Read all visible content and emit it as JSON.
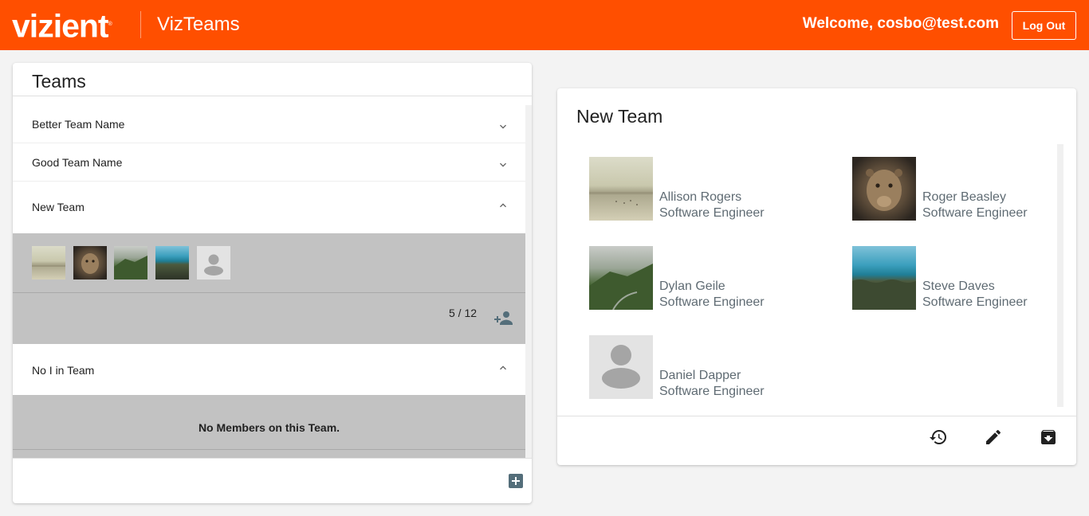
{
  "header": {
    "brand": "vizient",
    "app_name": "VizTeams",
    "welcome": "Welcome, cosbo@test.com",
    "logout_label": "Log Out",
    "bg_color": "#ff4f00"
  },
  "teams_panel": {
    "title": "Teams",
    "teams": [
      {
        "name": "Better Team Name",
        "expanded": false,
        "icon": "chevron-down-icon"
      },
      {
        "name": "Good Team Name",
        "expanded": false,
        "icon": "chevron-down-icon"
      },
      {
        "name": "New Team",
        "expanded": true,
        "icon": "chevron-up-icon",
        "member_count": "5 / 12",
        "thumbnails": [
          "beach-photo",
          "lion-photo",
          "cliff-photo",
          "sea-photo",
          "default-avatar-icon"
        ]
      },
      {
        "name": "No I in Team",
        "expanded": true,
        "icon": "chevron-up-icon",
        "empty_message": "No Members on this Team."
      }
    ],
    "add_team_icon": "add-box-icon"
  },
  "team_detail": {
    "title": "New Team",
    "members": [
      {
        "name": "Allison Rogers",
        "role": "Software Engineer",
        "photo": "beach-photo"
      },
      {
        "name": "Roger Beasley",
        "role": "Software Engineer",
        "photo": "lion-photo"
      },
      {
        "name": "Dylan Geile",
        "role": "Software Engineer",
        "photo": "cliff-photo"
      },
      {
        "name": "Steve Daves",
        "role": "Software Engineer",
        "photo": "sea-photo"
      },
      {
        "name": "Daniel Dapper",
        "role": "Software Engineer",
        "photo": "default-avatar"
      }
    ],
    "actions": [
      "history-icon",
      "edit-icon",
      "archive-icon"
    ]
  }
}
